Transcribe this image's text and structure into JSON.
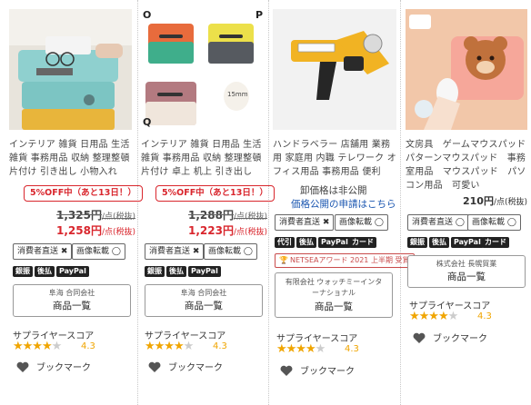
{
  "products": [
    {
      "title": "インテリア 雑貨 日用品 生活雑貨 事務用品 収納 整理整頓 片付け 引き出し 小物入れ",
      "sale": "5%OFF中（あと13日！）",
      "old_price": "1,325円",
      "new_price": "1,258円",
      "tags": [
        "消費者直送 ✖",
        "画像転載 ◯"
      ],
      "pills": [
        "銀振",
        "後払",
        "PayPal"
      ],
      "shop_name": "阜海 合同会社",
      "rating": 4.3
    },
    {
      "title": "インテリア 雑貨 日用品 生活雑貨 事務用品 収納 整理整頓 片付け 卓上 机上 引き出し",
      "sale": "5%OFF中（あと13日！）",
      "old_price": "1,288円",
      "new_price": "1,223円",
      "tags": [
        "消費者直送 ✖",
        "画像転載 ◯"
      ],
      "pills": [
        "銀振",
        "後払",
        "PayPal"
      ],
      "shop_name": "阜海 合同会社",
      "rating": 4.3,
      "image_labels": [
        "O",
        "P",
        "Q",
        "15mm"
      ]
    },
    {
      "title": "ハンドラベラー 店舗用 業務用 家庭用 内職 テレワーク オフィス用品 事務用品 便利",
      "price_closed": "卸価格は非公開",
      "price_link": "価格公開の申請はこちら",
      "tags": [
        "消費者直送 ✖",
        "画像転載 ◯"
      ],
      "pills": [
        "代引",
        "後払",
        "PayPal",
        "カード"
      ],
      "award": "NETSEAアワード 2021 上半期 受賞",
      "shop_name": "有限会社 ウォッチミーインターナショナル",
      "rating": 4.3
    },
    {
      "title": "文房具　ゲームマウスパッド　パターンマウスパッド　事務室用品　マウスパッド　パソコン用品　可愛い",
      "price": "210円",
      "tags": [
        "消費者直送 ◯",
        "画像転載 ◯"
      ],
      "pills": [
        "銀振",
        "後払",
        "PayPal",
        "カード"
      ],
      "shop_name": "株式会社 長幌貿業",
      "rating": 4.3
    }
  ],
  "ui": {
    "price_unit": "/点(税抜)",
    "shop_list_label": "商品一覧",
    "supplier_score_label": "サプライヤースコア",
    "bookmark_label": "ブックマーク"
  },
  "colors": {
    "sale_red": "#d9262d",
    "star": "#f0a500",
    "link": "#1a56b0"
  }
}
